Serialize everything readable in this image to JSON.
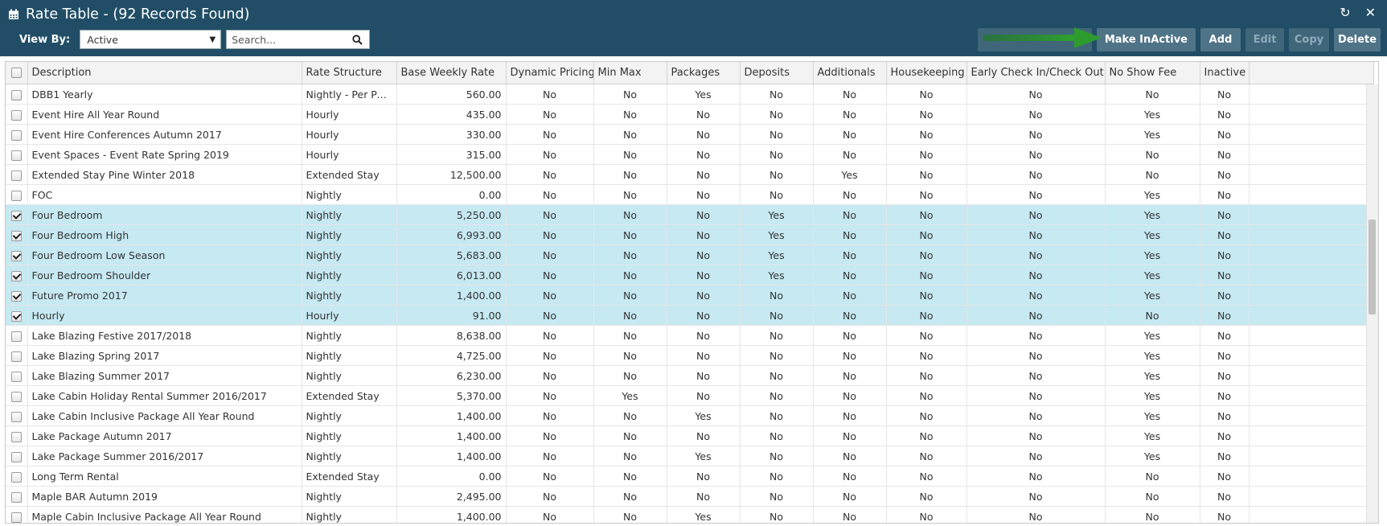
{
  "window": {
    "title": "Rate Table - (92 Records Found)",
    "title_icon": "calendar-icon",
    "refresh_icon": "refresh-icon",
    "close_icon": "close-icon"
  },
  "filter": {
    "view_by_label": "View By:",
    "view_by_value": "Active",
    "search_placeholder": "Search..."
  },
  "toolbar": {
    "make_inactive": "Make InActive",
    "add": "Add",
    "edit": "Edit",
    "copy": "Copy",
    "delete": "Delete"
  },
  "colors": {
    "header_bg": "#214e66",
    "button_bg": "#4f7487",
    "selected_row": "#c6e9f2",
    "annotation_arrow": "#2e9b2e"
  },
  "table": {
    "columns": [
      "Description",
      "Rate Structure",
      "Base Weekly Rate",
      "Dynamic Pricing",
      "Min Max",
      "Packages",
      "Deposits",
      "Additionals",
      "Housekeeping",
      "Early Check In/Check Out",
      "No Show Fee",
      "Inactive"
    ],
    "rows": [
      {
        "checked": false,
        "cells": [
          "DBB1 Yearly",
          "Nightly - Per Pers...",
          "560.00",
          "No",
          "No",
          "Yes",
          "No",
          "No",
          "No",
          "No",
          "No",
          "No"
        ]
      },
      {
        "checked": false,
        "cells": [
          "Event Hire All Year Round",
          "Hourly",
          "435.00",
          "No",
          "No",
          "No",
          "No",
          "No",
          "No",
          "No",
          "Yes",
          "No"
        ]
      },
      {
        "checked": false,
        "cells": [
          "Event Hire Conferences Autumn 2017",
          "Hourly",
          "330.00",
          "No",
          "No",
          "No",
          "No",
          "No",
          "No",
          "No",
          "Yes",
          "No"
        ]
      },
      {
        "checked": false,
        "cells": [
          "Event Spaces - Event Rate Spring 2019",
          "Hourly",
          "315.00",
          "No",
          "No",
          "No",
          "No",
          "No",
          "No",
          "No",
          "No",
          "No"
        ]
      },
      {
        "checked": false,
        "cells": [
          "Extended Stay Pine Winter 2018",
          "Extended Stay",
          "12,500.00",
          "No",
          "No",
          "No",
          "No",
          "Yes",
          "No",
          "No",
          "No",
          "No"
        ]
      },
      {
        "checked": false,
        "cells": [
          "FOC",
          "Nightly",
          "0.00",
          "No",
          "No",
          "No",
          "No",
          "No",
          "No",
          "No",
          "Yes",
          "No"
        ]
      },
      {
        "checked": true,
        "cells": [
          "Four Bedroom",
          "Nightly",
          "5,250.00",
          "No",
          "No",
          "No",
          "Yes",
          "No",
          "No",
          "No",
          "Yes",
          "No"
        ]
      },
      {
        "checked": true,
        "cells": [
          "Four Bedroom High",
          "Nightly",
          "6,993.00",
          "No",
          "No",
          "No",
          "Yes",
          "No",
          "No",
          "No",
          "Yes",
          "No"
        ]
      },
      {
        "checked": true,
        "cells": [
          "Four Bedroom Low Season",
          "Nightly",
          "5,683.00",
          "No",
          "No",
          "No",
          "Yes",
          "No",
          "No",
          "No",
          "Yes",
          "No"
        ]
      },
      {
        "checked": true,
        "cells": [
          "Four Bedroom Shoulder",
          "Nightly",
          "6,013.00",
          "No",
          "No",
          "No",
          "Yes",
          "No",
          "No",
          "No",
          "Yes",
          "No"
        ]
      },
      {
        "checked": true,
        "cells": [
          "Future Promo 2017",
          "Nightly",
          "1,400.00",
          "No",
          "No",
          "No",
          "No",
          "No",
          "No",
          "No",
          "Yes",
          "No"
        ]
      },
      {
        "checked": true,
        "cells": [
          "Hourly",
          "Hourly",
          "91.00",
          "No",
          "No",
          "No",
          "No",
          "No",
          "No",
          "No",
          "No",
          "No"
        ]
      },
      {
        "checked": false,
        "cells": [
          "Lake Blazing Festive 2017/2018",
          "Nightly",
          "8,638.00",
          "No",
          "No",
          "No",
          "No",
          "No",
          "No",
          "No",
          "Yes",
          "No"
        ]
      },
      {
        "checked": false,
        "cells": [
          "Lake Blazing Spring 2017",
          "Nightly",
          "4,725.00",
          "No",
          "No",
          "No",
          "No",
          "No",
          "No",
          "No",
          "Yes",
          "No"
        ]
      },
      {
        "checked": false,
        "cells": [
          "Lake Blazing Summer 2017",
          "Nightly",
          "6,230.00",
          "No",
          "No",
          "No",
          "No",
          "No",
          "No",
          "No",
          "Yes",
          "No"
        ]
      },
      {
        "checked": false,
        "cells": [
          "Lake Cabin Holiday Rental Summer 2016/2017",
          "Extended Stay",
          "5,370.00",
          "No",
          "Yes",
          "No",
          "No",
          "No",
          "No",
          "No",
          "Yes",
          "No"
        ]
      },
      {
        "checked": false,
        "cells": [
          "Lake Cabin Inclusive Package All Year Round",
          "Nightly",
          "1,400.00",
          "No",
          "No",
          "Yes",
          "No",
          "No",
          "No",
          "No",
          "Yes",
          "No"
        ]
      },
      {
        "checked": false,
        "cells": [
          "Lake Package Autumn 2017",
          "Nightly",
          "1,400.00",
          "No",
          "No",
          "No",
          "No",
          "No",
          "No",
          "No",
          "Yes",
          "No"
        ]
      },
      {
        "checked": false,
        "cells": [
          "Lake Package Summer 2016/2017",
          "Nightly",
          "1,400.00",
          "No",
          "No",
          "Yes",
          "No",
          "No",
          "No",
          "No",
          "Yes",
          "No"
        ]
      },
      {
        "checked": false,
        "cells": [
          "Long Term Rental",
          "Extended Stay",
          "0.00",
          "No",
          "No",
          "No",
          "No",
          "No",
          "No",
          "No",
          "No",
          "No"
        ]
      },
      {
        "checked": false,
        "cells": [
          "Maple BAR Autumn 2019",
          "Nightly",
          "2,495.00",
          "No",
          "No",
          "No",
          "No",
          "No",
          "No",
          "No",
          "No",
          "No"
        ]
      },
      {
        "checked": false,
        "cells": [
          "Maple Cabin Inclusive Package All Year Round",
          "Nightly",
          "1,400.00",
          "No",
          "No",
          "Yes",
          "No",
          "No",
          "No",
          "No",
          "No",
          "No"
        ]
      }
    ]
  }
}
